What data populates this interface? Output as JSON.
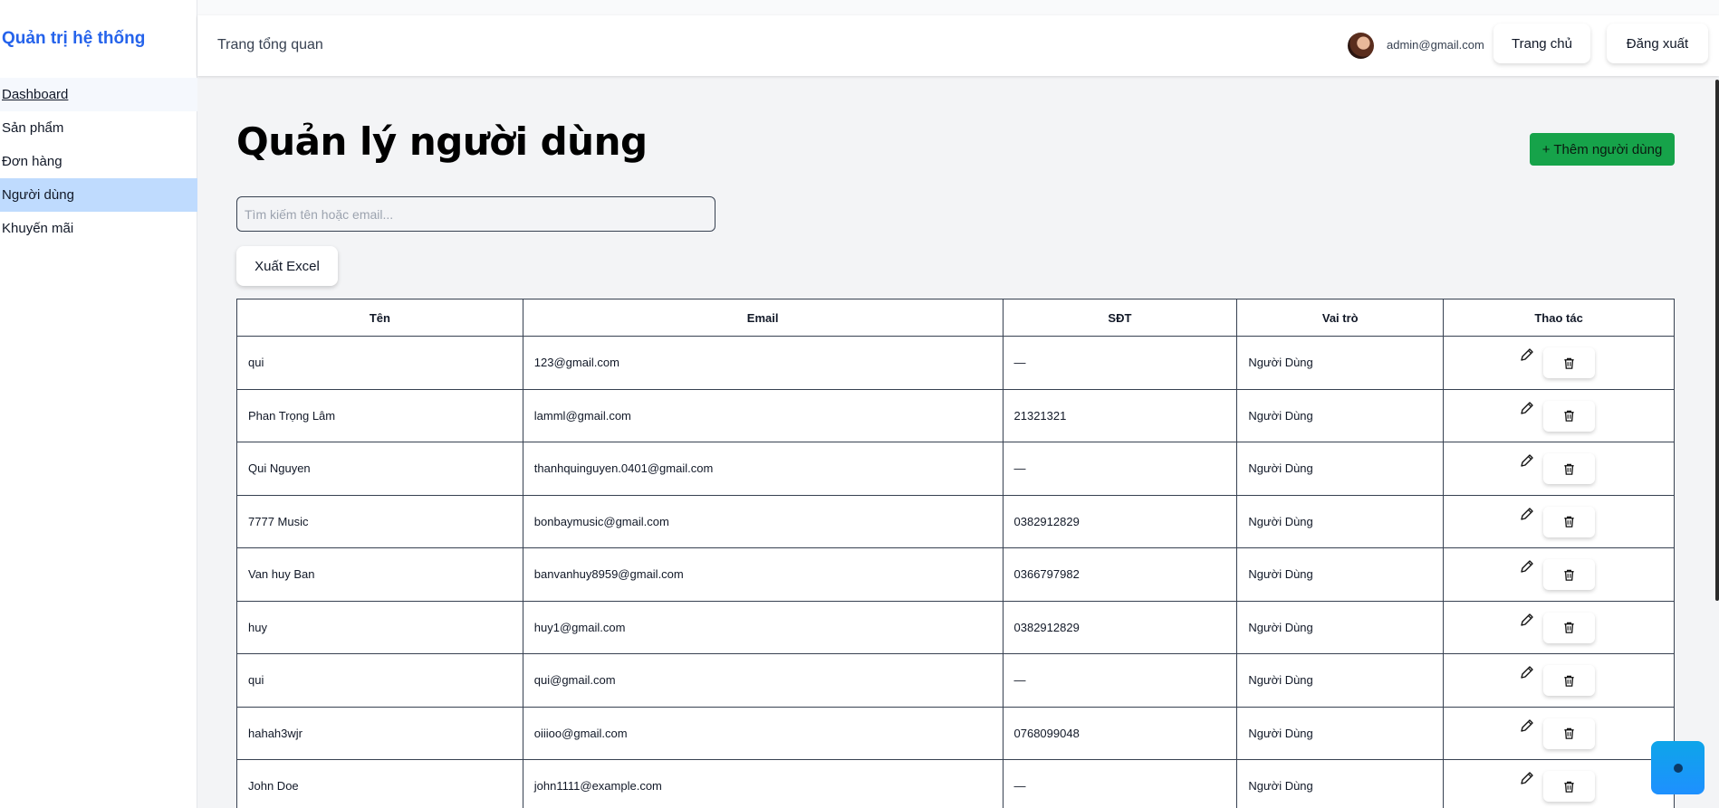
{
  "sidebar": {
    "brand": "Quản trị hệ thống",
    "items": [
      {
        "label": "Dashboard",
        "name": "sidebar-item-dashboard"
      },
      {
        "label": "Sản phẩm",
        "name": "sidebar-item-products"
      },
      {
        "label": "Đơn hàng",
        "name": "sidebar-item-orders"
      },
      {
        "label": "Người dùng",
        "name": "sidebar-item-users",
        "active": true
      },
      {
        "label": "Khuyến mãi",
        "name": "sidebar-item-promotions"
      }
    ]
  },
  "header": {
    "title": "Trang tổng quan",
    "user_email": "admin@gmail.com",
    "home_label": "Trang chủ",
    "logout_label": "Đăng xuất"
  },
  "main": {
    "title": "Quản lý người dùng",
    "add_label": "+ Thêm người dùng",
    "search_placeholder": "Tìm kiếm tên hoặc email...",
    "export_label": "Xuất Excel"
  },
  "table": {
    "columns": [
      "Tên",
      "Email",
      "SĐT",
      "Vai trò",
      "Thao tác"
    ],
    "rows": [
      [
        "qui",
        "123@gmail.com",
        "—",
        "Người Dùng"
      ],
      [
        "Phan Trọng Lâm",
        "lamml@gmail.com",
        "21321321",
        "Người Dùng"
      ],
      [
        "Qui Nguyen",
        "thanhquinguyen.0401@gmail.com",
        "—",
        "Người Dùng"
      ],
      [
        "7777 Music",
        "bonbaymusic@gmail.com",
        "0382912829",
        "Người Dùng"
      ],
      [
        "Van huy Ban",
        "banvanhuy8959@gmail.com",
        "0366797982",
        "Người Dùng"
      ],
      [
        "huy",
        "huy1@gmail.com",
        "0382912829",
        "Người Dùng"
      ],
      [
        "qui",
        "qui@gmail.com",
        "—",
        "Người Dùng"
      ],
      [
        "hahah3wjr",
        "oiiioo@gmail.com",
        "0768099048",
        "Người Dùng"
      ],
      [
        "John Doe",
        "john1111@example.com",
        "—",
        "Người Dùng"
      ]
    ]
  },
  "icons": {
    "edit": "pencil-icon",
    "delete": "trash-icon",
    "chat": "chat-icon"
  },
  "colors": {
    "brand": "#2563eb",
    "active_nav": "#bfdbfe",
    "add_button": "#16a34a",
    "chat_button": "#0ea5e9"
  }
}
